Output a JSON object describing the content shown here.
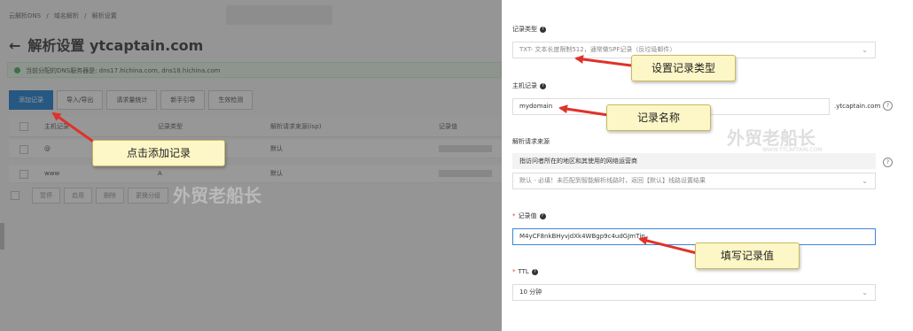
{
  "breadcrumb": [
    "云解析DNS",
    "/",
    "域名解析",
    "/",
    "解析设置"
  ],
  "page": {
    "title": "解析设置 ytcaptain.com"
  },
  "notice": {
    "text": "当前分配的DNS服务器是: dns17.hichina.com, dns18.hichina.com"
  },
  "toolbar": [
    "添加记录",
    "导入/导出",
    "请求量统计",
    "新手引导",
    "生效检测"
  ],
  "table": {
    "headers": [
      "主机记录",
      "记录类型",
      "解析请求来源(isp)",
      "记录值"
    ],
    "rows": [
      {
        "host": "@",
        "type": "A",
        "line": "默认"
      },
      {
        "host": "www",
        "type": "A",
        "line": "默认"
      }
    ],
    "bulk_buttons": [
      "暂停",
      "启用",
      "删除",
      "更换分组"
    ]
  },
  "watermark": {
    "text": "外贸老船长",
    "sub": "WWW.YTCAPTAIN.COM"
  },
  "form": {
    "record_type_label": "记录类型",
    "record_type_value": "TXT- 文本长度限制512，通常做SPF记录（反垃圾邮件）",
    "host_label": "主机记录",
    "host_value": "mydomain",
    "host_suffix": ".ytcaptain.com",
    "line_label": "解析请求来源",
    "line_hint": "指访问者所在的地区和其使用的网络运营商",
    "line_value": "默认 - 必填！未匹配到智能解析线路时，返回【默认】线路设置结果",
    "value_label": "记录值",
    "value_value": "M4yCF8nkBHyvjdXk4WBgp9c4udGJmTjp",
    "ttl_label": "TTL",
    "ttl_value": "10 分钟"
  },
  "callouts": {
    "add": "点击添加记录",
    "type": "设置记录类型",
    "name": "记录名称",
    "value": "填写记录值"
  },
  "colors": {
    "primary": "#0070cc",
    "callout_bg": "#fdf6c6",
    "arrow": "#e0312b",
    "required": "#e0432f"
  }
}
